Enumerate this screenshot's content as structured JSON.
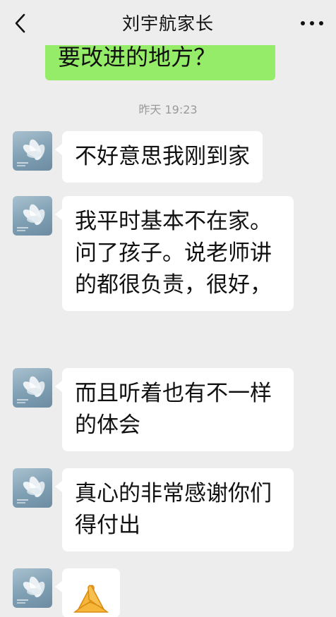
{
  "header": {
    "title": "刘宇航家长",
    "back_icon": "chevron-left-icon",
    "more_icon": "more-dots-icon"
  },
  "sent": {
    "text": "要改进的地方？"
  },
  "timestamp": "昨天 19:23",
  "messages": [
    {
      "text": "不好意思我刚到家"
    },
    {
      "text": "我平时基本不在家。问了孩子。说老师讲的都很负责，很好，"
    },
    {
      "text": "而且听着也有不一样的体会"
    },
    {
      "text": "真心的非常感谢你们得付出"
    },
    {
      "emoji": "folded-hands-emoji"
    }
  ],
  "colors": {
    "background": "#ededed",
    "sent_bubble": "#95ec69",
    "received_bubble": "#ffffff",
    "timestamp": "#9a9a9a"
  }
}
